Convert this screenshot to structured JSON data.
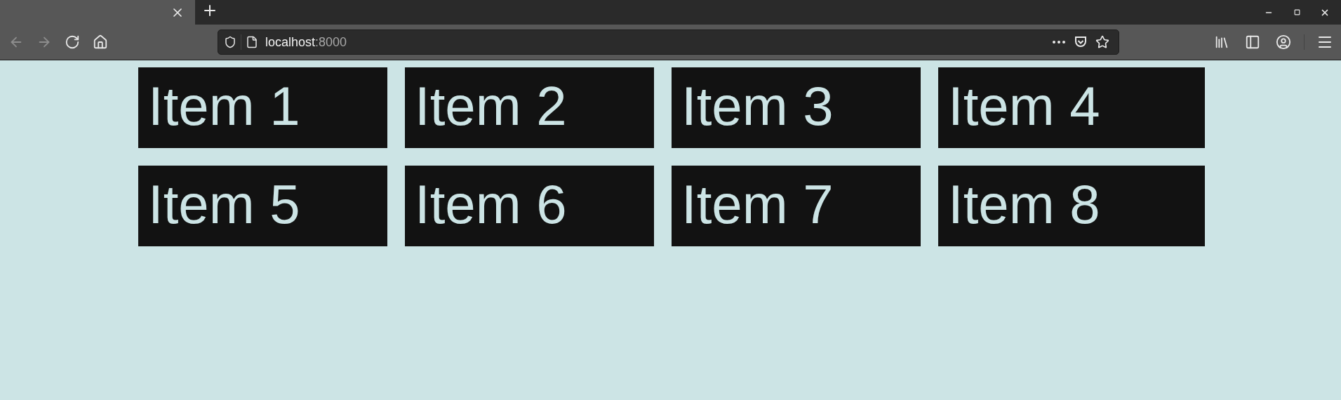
{
  "browser": {
    "nav_buttons": [
      {
        "kind": "back",
        "disabled": true
      },
      {
        "kind": "forward",
        "disabled": true
      },
      {
        "kind": "reload",
        "disabled": false
      },
      {
        "kind": "home",
        "disabled": false
      }
    ],
    "address": {
      "host": "localhost",
      "port": ":8000"
    }
  },
  "items": [
    {
      "label": "Item 1"
    },
    {
      "label": "Item 2"
    },
    {
      "label": "Item 3"
    },
    {
      "label": "Item 4"
    },
    {
      "label": "Item 5"
    },
    {
      "label": "Item 6"
    },
    {
      "label": "Item 7"
    },
    {
      "label": "Item 8"
    }
  ]
}
